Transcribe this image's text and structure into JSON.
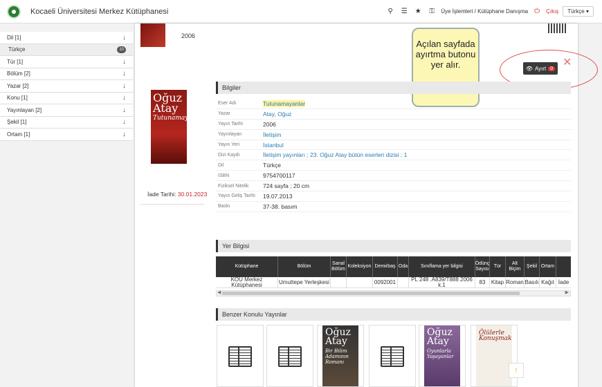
{
  "header": {
    "title": "Kocaeli Üniversitesi Merkez Kütüphanesi",
    "member_link": "Üye İşlemleri / Kütüphane Danışma",
    "logout": "Çıkış",
    "language": "Türkçe"
  },
  "sidebar": {
    "items": [
      {
        "label": "Dil [1]"
      },
      {
        "label": "Türkçe",
        "count": "10"
      },
      {
        "label": "Tür [1]"
      },
      {
        "label": "Bölüm [2]"
      },
      {
        "label": "Yazar [2]"
      },
      {
        "label": "Konu [1]"
      },
      {
        "label": "Yayınlayan [2]"
      },
      {
        "label": "Şekil [1]"
      },
      {
        "label": "Ortam [1]"
      }
    ]
  },
  "top": {
    "year": "2006"
  },
  "callout": {
    "text": "Açılan sayfada ayırtma butonu yer alır."
  },
  "sort_button": {
    "label": "Ayırt",
    "badge": "0"
  },
  "cover": {
    "author": "Oğuz Atay",
    "title": "Tutunamayanlar"
  },
  "due": {
    "label": "İade Tarihi:",
    "date": "30.01.2023"
  },
  "info": {
    "header": "Bilgiler",
    "rows": [
      {
        "k": "Eser Adı",
        "v": "Tutunamayanlar"
      },
      {
        "k": "Yazar",
        "v": "Atay, Oğuz"
      },
      {
        "k": "Yayın Tarihi",
        "v": "2006"
      },
      {
        "k": "Yayınlayan",
        "v": "İletişim"
      },
      {
        "k": "Yayın Yeri",
        "v": "İstanbul"
      },
      {
        "k": "Dizi Kaydı",
        "v": "İletişim yayınları ; 23. Oğuz Atay bütün eserleri dizisi ; 1"
      },
      {
        "k": "Dil",
        "v": "Türkçe"
      },
      {
        "k": "ISBN",
        "v": "9754700117"
      },
      {
        "k": "Fiziksel Nitelik",
        "v": "724 sayfa ; 20 cm"
      },
      {
        "k": "Yayın Geliş Tarihi",
        "v": "19.07.2013"
      },
      {
        "k": "Baskı",
        "v": "37-38. basım"
      }
    ]
  },
  "location": {
    "header": "Yer Bilgisi",
    "columns": [
      "Kütüphane",
      "Bölüm",
      "Sanal Bölüm",
      "Koleksiyon",
      "Demirbaş",
      "Oda",
      "Sınıflama yer bilgisi",
      "Ödünç Sayısı",
      "Tür",
      "Alt Biçim",
      "Şekil",
      "Ortam",
      ""
    ],
    "row": [
      "KOÜ Merkez Kütüphanesi",
      "Umuttepe Yerleşkesi",
      "",
      "",
      "0092001",
      "",
      "PL 248 .A839/T888 2006 k.1",
      "83",
      "Kitap",
      "Roman",
      "Basılı",
      "Kağıt",
      "İade"
    ]
  },
  "similar": {
    "header": "Benzer Konulu Yayınlar",
    "covers": [
      {
        "author": "Oğuz Atay",
        "title": "Bir Bilim Adamının Romanı"
      },
      {
        "author": "Oğuz Atay",
        "title": "Oyunlarla Yaşayanlar"
      },
      {
        "author": "Ölülerle Konuşmak",
        "title": ""
      }
    ]
  }
}
